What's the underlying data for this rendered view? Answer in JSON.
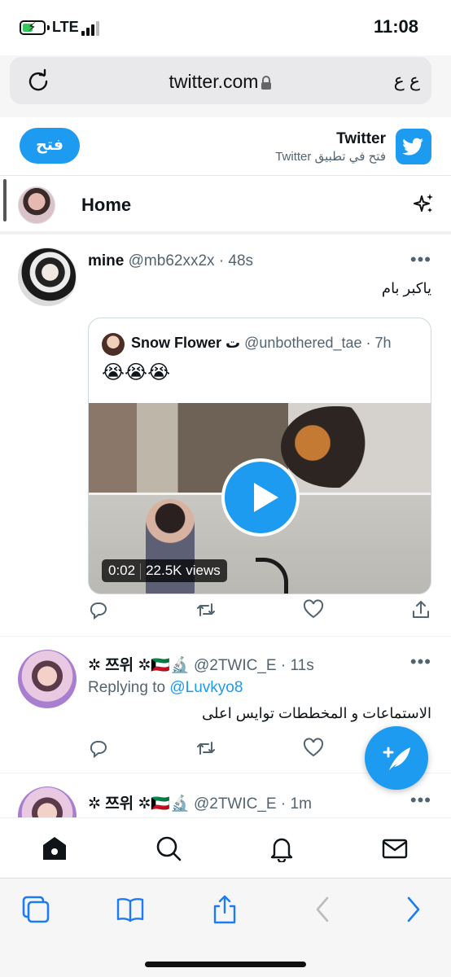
{
  "status_bar": {
    "network": "LTE",
    "time": "11:08"
  },
  "address_bar": {
    "url": "twitter.com",
    "aa_label": "ع ع"
  },
  "app_banner": {
    "open_button": "فتح",
    "title": "Twitter",
    "subtitle": "فتح في تطبيق Twitter"
  },
  "header": {
    "title": "Home"
  },
  "tweets": [
    {
      "name": "mine",
      "handle": "@mb62xx2x",
      "time": "· 48s",
      "text": "ياكبر بام",
      "more": "•••",
      "quote": {
        "name": "Snow Flower ت",
        "handle": "@unbothered_tae",
        "time": "· 7h",
        "emoji": "😭😭😭",
        "video_time": "0:02",
        "video_views": "22.5K views"
      }
    },
    {
      "name": "✲ 쯔위 ✲🇰🇼🔬",
      "handle": "@2TWIC_E",
      "time": "· 11s",
      "replying_prefix": "Replying to",
      "replying_handle": "@Luvkyo8",
      "text": "الاستماعات و المخططات توايس اعلى",
      "more": "•••"
    },
    {
      "name": "✲ 쯔위 ✲🇰🇼🔬",
      "handle": "@2TWIC_E",
      "time": "· 1m",
      "more": "•••"
    }
  ],
  "colors": {
    "accent": "#1d9bf0",
    "text": "#0f1419",
    "muted": "#536471"
  }
}
